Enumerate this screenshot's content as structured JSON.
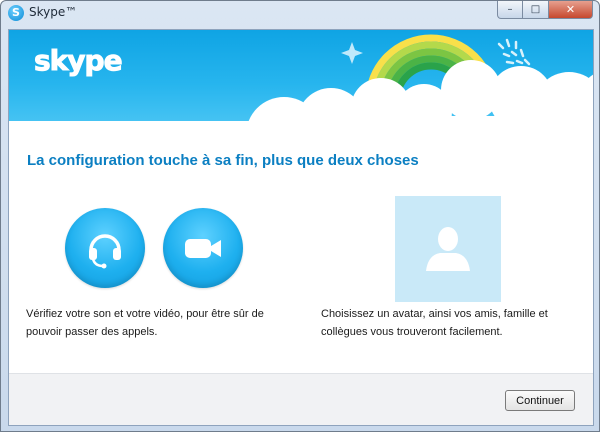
{
  "window": {
    "title": "Skype™",
    "icon": "skype-icon",
    "controls": {
      "minimize": "–",
      "maximize": "□",
      "close": "✕"
    }
  },
  "banner": {
    "logo_text": "skype"
  },
  "main": {
    "headline": "La configuration touche à sa fin, plus que deux choses",
    "left": {
      "icons": [
        "headset-icon",
        "video-camera-icon"
      ],
      "description": "Vérifiez votre son et votre vidéo, pour être sûr de pouvoir passer des appels."
    },
    "right": {
      "icon": "avatar-placeholder-icon",
      "description": "Choisissez un avatar, ainsi vos amis, famille et collègues vous trouveront facilement."
    }
  },
  "footer": {
    "continue_label": "Continuer"
  },
  "colors": {
    "accent": "#0b7fc2",
    "banner": "#1ea9e8",
    "circle": "#1eb0ef",
    "avatar_bg": "#c9e9f8"
  }
}
